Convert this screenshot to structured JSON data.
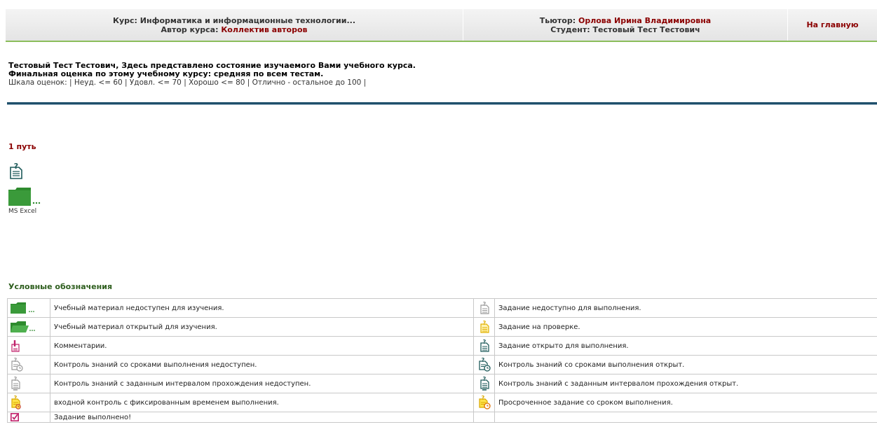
{
  "header": {
    "course_label": "Курс:",
    "course_name": "Информатика и информационные технологии...",
    "author_label": "Автор курса:",
    "author_name": "Коллектив авторов",
    "tutor_label": "Тьютор:",
    "tutor_name": "Орлова Ирина Владимировна",
    "student_label": "Студент:",
    "student_name": "Тестовый Тест Тестович",
    "home_link": "На главную"
  },
  "intro": {
    "line1": "Тестовый Тест Тестович, Здесь представлено состояние изучаемого Вами учебного курса.",
    "line2": "Финальная оценка по этому учебному курсу: средняя по всем тестам.",
    "scale": "Шкала оценок: | Неуд. <= 60 | Удовл. <= 70 | Хорошо <= 80 | Отлично - остальное до 100 |"
  },
  "path": {
    "title": "1 путь",
    "folder_label": "MS Excel"
  },
  "legend": {
    "title": "Условные обозначения",
    "rows": [
      {
        "left_icon": "folder-closed-icon",
        "left": "Учебный материал недоступен для изучения.",
        "right_icon": "test-gray-icon",
        "right": "Задание недоступно для выполнения."
      },
      {
        "left_icon": "folder-open-icon",
        "left": "Учебный материал открытый для изучения.",
        "right_icon": "test-yellow-icon",
        "right": "Задание на проверке."
      },
      {
        "left_icon": "comment-icon",
        "left": "Комментарии.",
        "right_icon": "test-open-icon",
        "right": "Задание открыто для выполнения."
      },
      {
        "left_icon": "deadline-gray-icon",
        "left": "Контроль знаний со сроками выполнения недоступен.",
        "right_icon": "deadline-open-icon",
        "right": "Контроль знаний со сроками выполнения открыт."
      },
      {
        "left_icon": "interval-gray-icon",
        "left": "Контроль знаний с заданным интервалом прохождения недоступен.",
        "right_icon": "interval-open-icon",
        "right": "Контроль знаний с заданным интервалом прохождения открыт."
      },
      {
        "left_icon": "entry-timer-icon",
        "left": "входной контроль с фиксированным временем выполнения.",
        "right_icon": "overdue-icon",
        "right": "Просроченное задание со сроком выполнения."
      },
      {
        "left_icon": "done-check-icon",
        "left": "Задание выполнено!",
        "right_icon": "",
        "right": ""
      }
    ]
  },
  "colors": {
    "accent_red": "#8b0000",
    "accent_green": "#8bbd5b",
    "folder_green": "#2e8b2e",
    "teal": "#1e5a5a"
  }
}
